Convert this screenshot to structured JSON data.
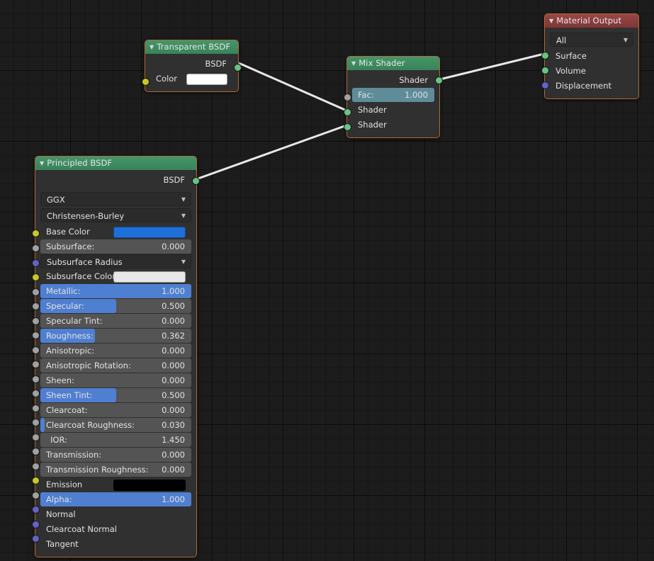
{
  "app": {
    "editor": "Shader Node Editor",
    "background_color": "#1c1c1c"
  },
  "colors": {
    "header_shader": "#3a8359",
    "header_output": "#7e3636",
    "node_body": "#303030",
    "node_border_selected": "#b06a34",
    "slider_fill_blue": "#4f7fd1",
    "slider_fill_teal": "#5f8c99",
    "socket_shader": "#66c485",
    "socket_color": "#c7c729",
    "socket_value": "#a1a1a1",
    "socket_vector": "#6363c7",
    "base_color_swatch": "#1f6fd8",
    "subsurface_color_swatch": "#e8e8e8",
    "emission_swatch": "#000000",
    "transparent_color_swatch": "#ffffff",
    "noodle": "#e8e8e8"
  },
  "nodes": {
    "transparent_bsdf": {
      "title": "Transparent BSDF",
      "collapse_icon": "triangle-down-icon",
      "outputs": [
        {
          "name": "BSDF",
          "socket": "shader"
        }
      ],
      "inputs": [
        {
          "name": "Color",
          "socket": "color",
          "swatch": "#ffffff"
        }
      ]
    },
    "mix_shader": {
      "title": "Mix Shader",
      "collapse_icon": "triangle-down-icon",
      "outputs": [
        {
          "name": "Shader",
          "socket": "shader"
        }
      ],
      "inputs": [
        {
          "name": "Fac:",
          "socket": "value",
          "value": "1.000",
          "fill_pct": 100,
          "fill": "teal"
        },
        {
          "name": "Shader",
          "socket": "shader"
        },
        {
          "name": "Shader",
          "socket": "shader"
        }
      ]
    },
    "material_output": {
      "title": "Material Output",
      "collapse_icon": "triangle-down-icon",
      "target_dropdown": {
        "value": "All",
        "chevron": "chevron-down-icon"
      },
      "inputs": [
        {
          "name": "Surface",
          "socket": "shader"
        },
        {
          "name": "Volume",
          "socket": "shader"
        },
        {
          "name": "Displacement",
          "socket": "vector"
        }
      ]
    },
    "principled_bsdf": {
      "title": "Principled BSDF",
      "collapse_icon": "triangle-down-icon",
      "outputs": [
        {
          "name": "BSDF",
          "socket": "shader"
        }
      ],
      "dropdowns": [
        {
          "value": "GGX",
          "chevron": "chevron-down-icon"
        },
        {
          "value": "Christensen-Burley",
          "chevron": "chevron-down-icon"
        }
      ],
      "inputs": [
        {
          "name": "Base Color",
          "socket": "color",
          "type": "swatch",
          "swatch": "#1f6fd8"
        },
        {
          "name": "Subsurface:",
          "socket": "value",
          "type": "slider",
          "value": "0.000",
          "fill_pct": 0
        },
        {
          "name": "Subsurface Radius",
          "socket": "vector",
          "type": "dropdown",
          "chevron": "chevron-down-icon"
        },
        {
          "name": "Subsurface Color",
          "socket": "color",
          "type": "swatch",
          "swatch": "#e8e8e8"
        },
        {
          "name": "Metallic:",
          "socket": "value",
          "type": "slider",
          "value": "1.000",
          "fill_pct": 100
        },
        {
          "name": "Specular:",
          "socket": "value",
          "type": "slider",
          "value": "0.500",
          "fill_pct": 50
        },
        {
          "name": "Specular Tint:",
          "socket": "value",
          "type": "slider",
          "value": "0.000",
          "fill_pct": 0
        },
        {
          "name": "Roughness:",
          "socket": "value",
          "type": "slider",
          "value": "0.362",
          "fill_pct": 36.2
        },
        {
          "name": "Anisotropic:",
          "socket": "value",
          "type": "slider",
          "value": "0.000",
          "fill_pct": 0
        },
        {
          "name": "Anisotropic Rotation:",
          "socket": "value",
          "type": "slider",
          "value": "0.000",
          "fill_pct": 0
        },
        {
          "name": "Sheen:",
          "socket": "value",
          "type": "slider",
          "value": "0.000",
          "fill_pct": 0
        },
        {
          "name": "Sheen Tint:",
          "socket": "value",
          "type": "slider",
          "value": "0.500",
          "fill_pct": 50
        },
        {
          "name": "Clearcoat:",
          "socket": "value",
          "type": "slider",
          "value": "0.000",
          "fill_pct": 0
        },
        {
          "name": "Clearcoat Roughness:",
          "socket": "value",
          "type": "slider",
          "value": "0.030",
          "fill_pct": 3
        },
        {
          "name": "IOR:",
          "socket": "value",
          "type": "slider",
          "value": "1.450",
          "fill_pct": 0
        },
        {
          "name": "Transmission:",
          "socket": "value",
          "type": "slider",
          "value": "0.000",
          "fill_pct": 0
        },
        {
          "name": "Transmission Roughness:",
          "socket": "value",
          "type": "slider",
          "value": "0.000",
          "fill_pct": 0
        },
        {
          "name": "Emission",
          "socket": "color",
          "type": "swatch",
          "swatch": "#000000"
        },
        {
          "name": "Alpha:",
          "socket": "value",
          "type": "slider",
          "value": "1.000",
          "fill_pct": 100
        },
        {
          "name": "Normal",
          "socket": "vector",
          "type": "label"
        },
        {
          "name": "Clearcoat Normal",
          "socket": "vector",
          "type": "label"
        },
        {
          "name": "Tangent",
          "socket": "vector",
          "type": "label"
        }
      ]
    }
  },
  "links": [
    {
      "from": "transparent_bsdf.BSDF",
      "to": "mix_shader.Shader_1"
    },
    {
      "from": "principled_bsdf.BSDF",
      "to": "mix_shader.Shader_2"
    },
    {
      "from": "mix_shader.Shader",
      "to": "material_output.Surface"
    }
  ]
}
